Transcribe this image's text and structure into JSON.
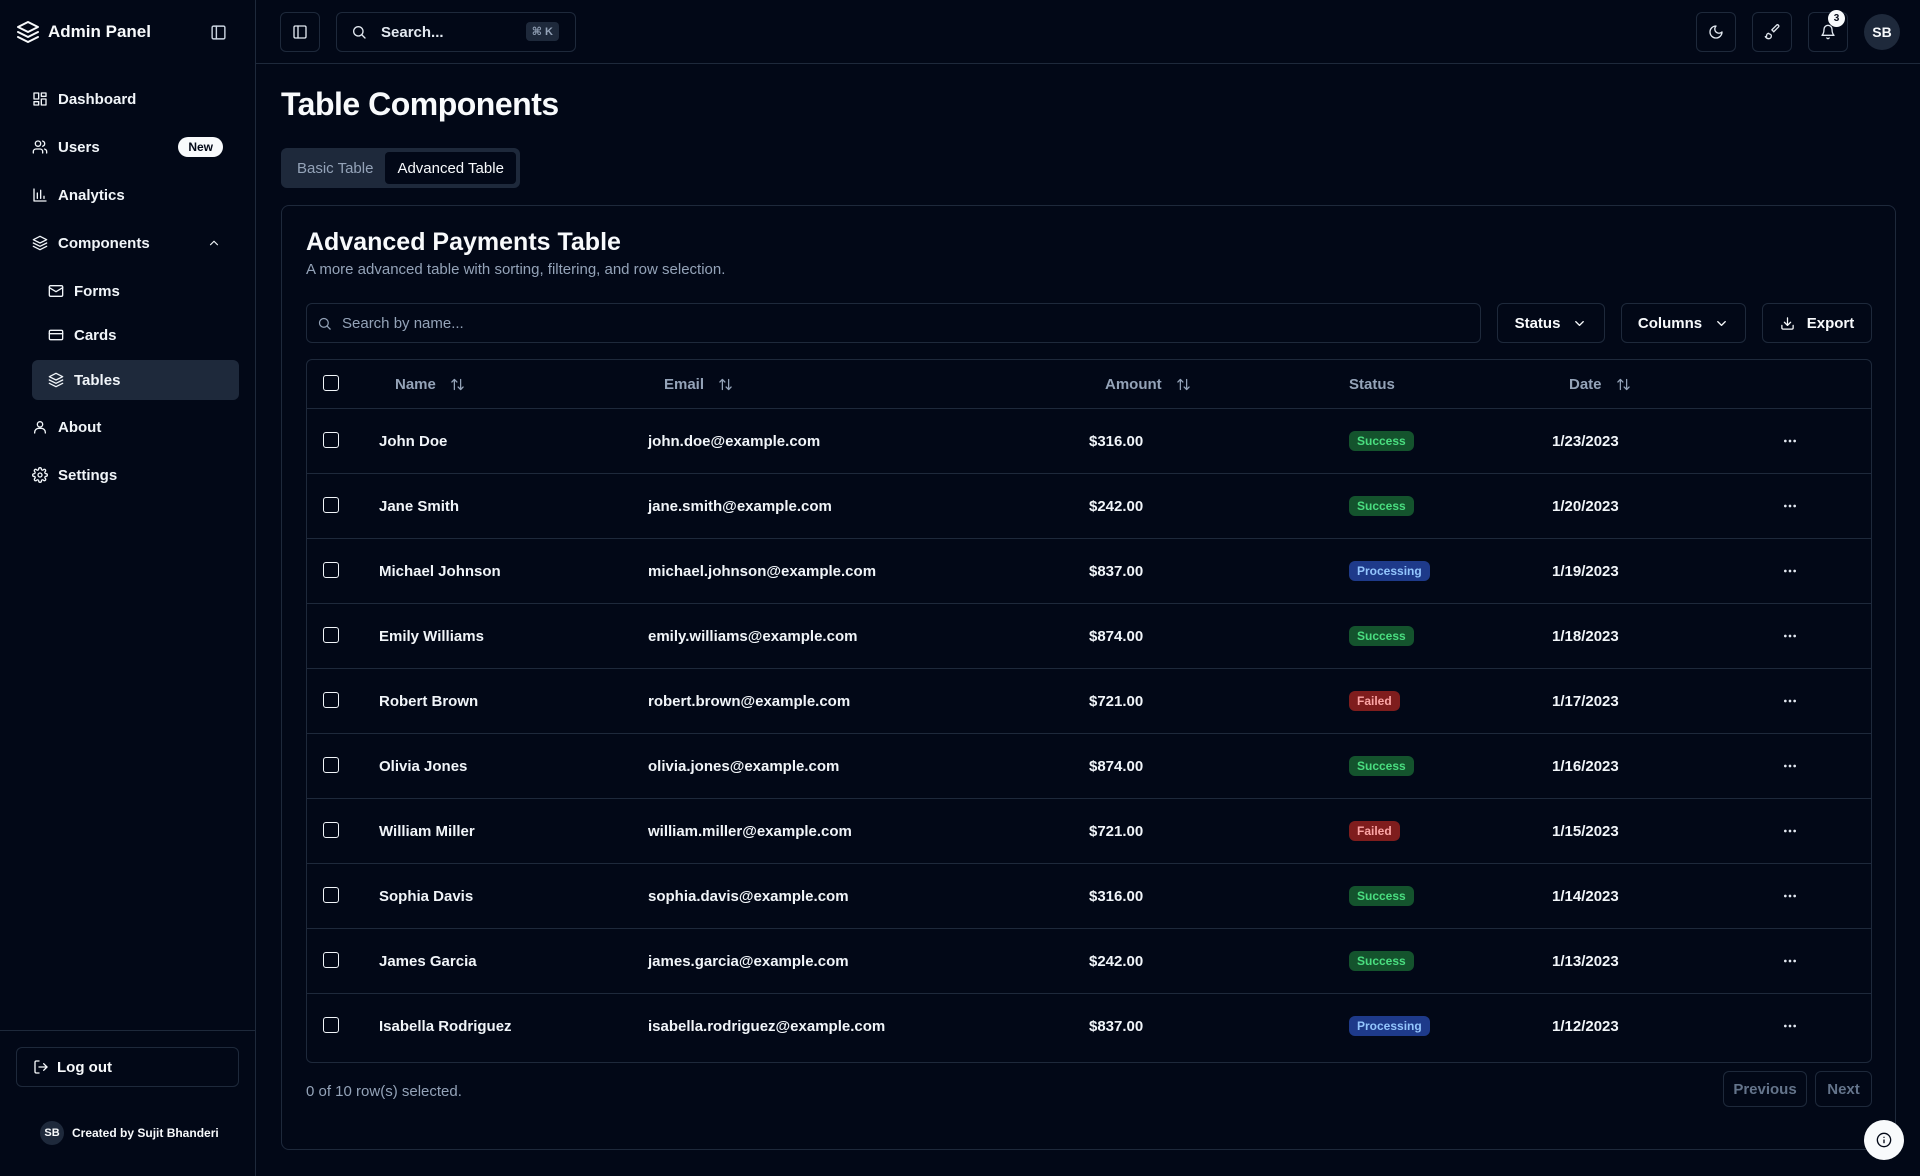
{
  "brand": {
    "title": "Admin Panel",
    "icon": "layers-icon"
  },
  "sidebar": {
    "items": [
      {
        "label": "Dashboard",
        "icon": "layout-grid-icon"
      },
      {
        "label": "Users",
        "icon": "users-icon",
        "badge": "New"
      },
      {
        "label": "Analytics",
        "icon": "bar-chart-icon"
      },
      {
        "label": "Components",
        "icon": "layers-icon",
        "expanded": true,
        "children": [
          {
            "label": "Forms",
            "icon": "mail-icon"
          },
          {
            "label": "Cards",
            "icon": "credit-card-icon"
          },
          {
            "label": "Tables",
            "icon": "layers-icon",
            "active": true
          }
        ]
      },
      {
        "label": "About",
        "icon": "user-icon"
      },
      {
        "label": "Settings",
        "icon": "gear-icon"
      }
    ],
    "logout_label": "Log out",
    "creator_initials": "SB",
    "creator_text": "Created by Sujit Bhanderi"
  },
  "topbar": {
    "search_placeholder": "Search...",
    "shortcut": "⌘ K",
    "notification_count": "3",
    "avatar_initials": "SB"
  },
  "page": {
    "title": "Table Components",
    "tabs": [
      {
        "label": "Basic Table",
        "active": false
      },
      {
        "label": "Advanced Table",
        "active": true
      }
    ]
  },
  "card": {
    "title": "Advanced Payments Table",
    "description": "A more advanced table with sorting, filtering, and row selection.",
    "filter_placeholder": "Search by name...",
    "status_button": "Status",
    "columns_button": "Columns",
    "export_button": "Export"
  },
  "table": {
    "headers": {
      "name": "Name",
      "email": "Email",
      "amount": "Amount",
      "status": "Status",
      "date": "Date"
    },
    "rows": [
      {
        "name": "John Doe",
        "email": "john.doe@example.com",
        "amount": "$316.00",
        "status": "Success",
        "date": "1/23/2023"
      },
      {
        "name": "Jane Smith",
        "email": "jane.smith@example.com",
        "amount": "$242.00",
        "status": "Success",
        "date": "1/20/2023"
      },
      {
        "name": "Michael Johnson",
        "email": "michael.johnson@example.com",
        "amount": "$837.00",
        "status": "Processing",
        "date": "1/19/2023"
      },
      {
        "name": "Emily Williams",
        "email": "emily.williams@example.com",
        "amount": "$874.00",
        "status": "Success",
        "date": "1/18/2023"
      },
      {
        "name": "Robert Brown",
        "email": "robert.brown@example.com",
        "amount": "$721.00",
        "status": "Failed",
        "date": "1/17/2023"
      },
      {
        "name": "Olivia Jones",
        "email": "olivia.jones@example.com",
        "amount": "$874.00",
        "status": "Success",
        "date": "1/16/2023"
      },
      {
        "name": "William Miller",
        "email": "william.miller@example.com",
        "amount": "$721.00",
        "status": "Failed",
        "date": "1/15/2023"
      },
      {
        "name": "Sophia Davis",
        "email": "sophia.davis@example.com",
        "amount": "$316.00",
        "status": "Success",
        "date": "1/14/2023"
      },
      {
        "name": "James Garcia",
        "email": "james.garcia@example.com",
        "amount": "$242.00",
        "status": "Success",
        "date": "1/13/2023"
      },
      {
        "name": "Isabella Rodriguez",
        "email": "isabella.rodriguez@example.com",
        "amount": "$837.00",
        "status": "Processing",
        "date": "1/12/2023"
      }
    ],
    "selection_text": "0 of 10 row(s) selected.",
    "previous_label": "Previous",
    "next_label": "Next"
  },
  "colors": {
    "background": "#020817",
    "border": "#1e293b",
    "success": "#4ade80",
    "processing": "#93c5fd",
    "failed": "#fca5a5"
  }
}
